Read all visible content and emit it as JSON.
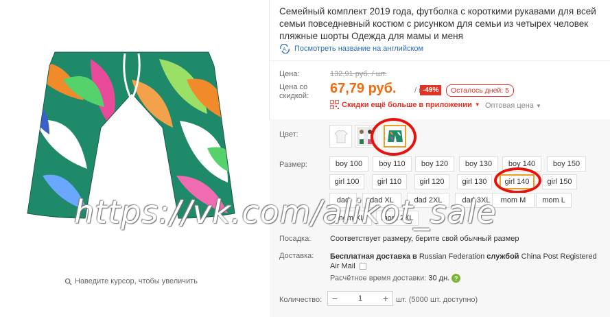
{
  "product": {
    "title": "Семейный комплект 2019 года, футболка с короткими рукавами для всей семьи повседневный костюм с рисунком для семьи из четырех человек пляжные шорты Одежда для мамы и меня",
    "translate_link": "Посмотреть название на английском",
    "zoom_hint": "Наведите курсор, чтобы увеличить"
  },
  "price": {
    "label": "Цена:",
    "old": "132,91 руб. / шт.",
    "sale_label": "Цена со скидкой:",
    "new": "67,79 руб.",
    "per_unit": "/ шт.",
    "discount": "-49%",
    "days_left": "Осталось дней: 5",
    "app_discount": "Скидки ещё больше в приложении",
    "wholesale": "Оптовая цена"
  },
  "color": {
    "label": "Цвет:",
    "selected_index": 2
  },
  "size": {
    "label": "Размер:",
    "rows": [
      [
        "boy 100",
        "boy 110",
        "boy 120",
        "boy 130",
        "boy 140",
        "boy 150"
      ],
      [
        "girl 100",
        "girl 110",
        "girl 120",
        "girl 130",
        "girl 140",
        "girl 150"
      ],
      [
        "dad",
        "dad XL",
        "dad 2XL",
        "dad 3XL",
        "mom M",
        "mom L"
      ],
      [
        "mom XL",
        "mom 2XL"
      ]
    ],
    "selected": "girl 140"
  },
  "fit": {
    "label": "Посадка:",
    "value": "Соответствует размеру, берите свой обычный размер"
  },
  "delivery": {
    "label": "Доставка:",
    "line1_bold1": "Бесплатная доставка в",
    "line1_country": "Russian Federation",
    "line1_bold2": "службой",
    "line1_service": "China Post Registered",
    "line2_service": "Air Mail",
    "eta_label": "Расчётное время доставки:",
    "eta_value": "30 дн."
  },
  "quantity": {
    "label": "Количество:",
    "value": "1",
    "available": "шт. (5000 шт. доступно)"
  },
  "watermark": "https://vk.com/alikot_sale",
  "colors": {
    "accent": "#f06b0e",
    "discount_red": "#e43225",
    "link_blue": "#2a6dbb",
    "highlight_circle": "#e8120c"
  },
  "icons": [
    "search-icon",
    "translate-icon",
    "qr-code-icon",
    "chevron-down-icon",
    "help-icon",
    "minus-icon",
    "plus-icon"
  ]
}
